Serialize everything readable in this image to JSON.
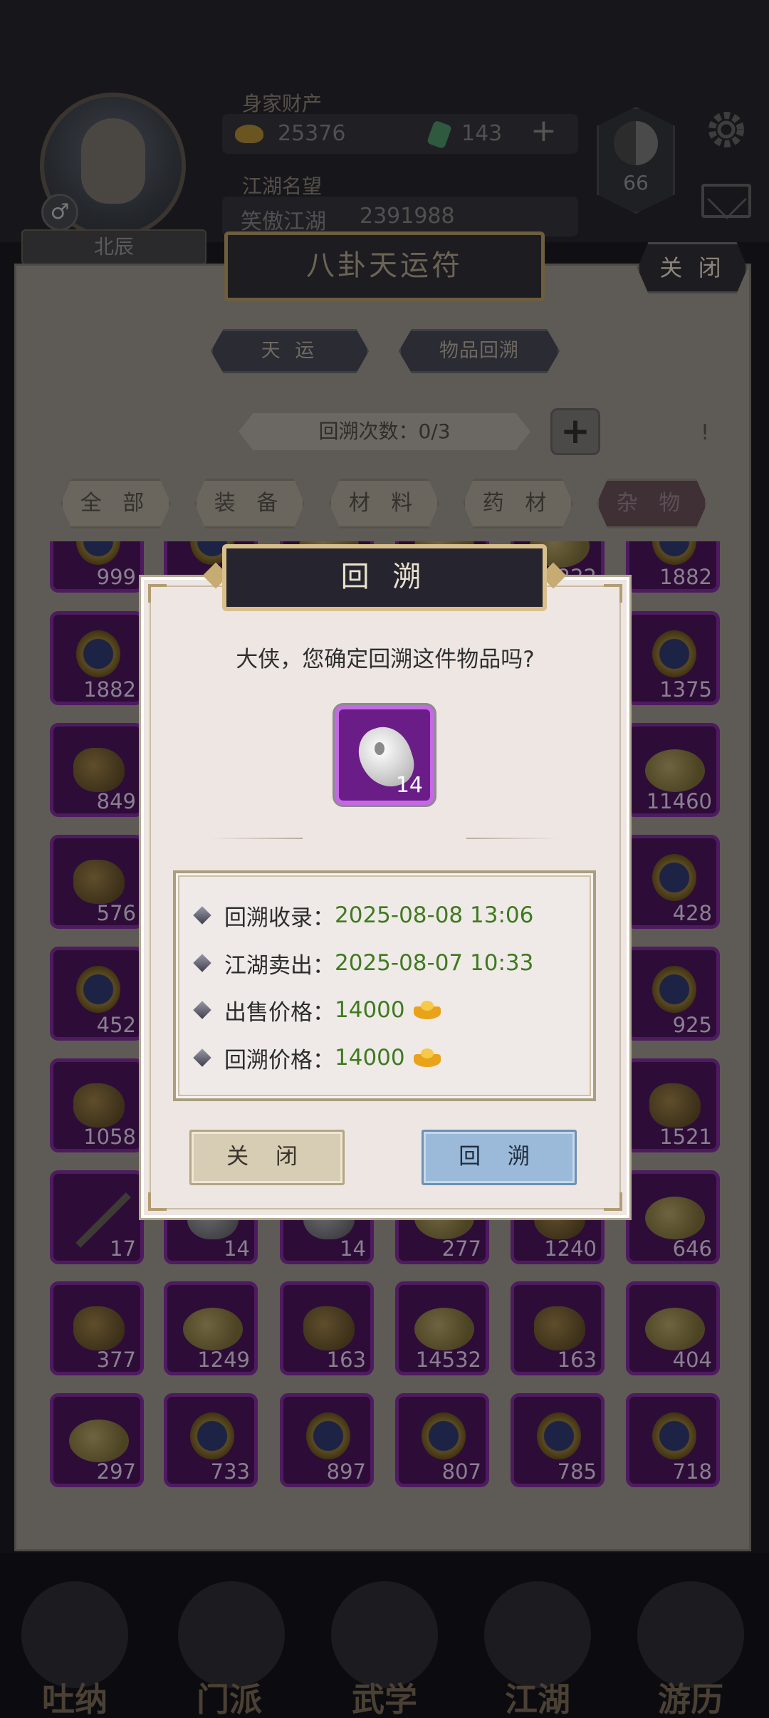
{
  "hud": {
    "wealth_label": "身家财产",
    "gold": "25376",
    "jade": "143",
    "fame_label": "江湖名望",
    "fame_title": "笑傲江湖",
    "fame_value": "2391988",
    "taiji_level": "66",
    "player_name": "北辰"
  },
  "panel": {
    "title": "八卦天运符",
    "close_label": "关 闭",
    "tabs": [
      "天 运",
      "物品回溯"
    ],
    "recall_count_label": "回溯次数：",
    "recall_count_value": "0/3",
    "info_mark": "!",
    "categories": [
      "全 部",
      "装 备",
      "材 料",
      "药 材",
      "杂 物"
    ],
    "active_category": "杂 物"
  },
  "grid": {
    "rows": [
      [
        {
          "icon": "amulet",
          "count": "999"
        },
        {
          "icon": "amulet",
          "count": ""
        },
        {
          "icon": "gold",
          "count": ""
        },
        {
          "icon": "gold",
          "count": ""
        },
        {
          "icon": "gold",
          "count": "222"
        },
        {
          "icon": "amulet",
          "count": "1882"
        }
      ],
      [
        {
          "icon": "amulet",
          "count": "1882"
        },
        {
          "icon": "amulet",
          "count": ""
        },
        {
          "icon": "amulet",
          "count": ""
        },
        {
          "icon": "amulet",
          "count": ""
        },
        {
          "icon": "amulet",
          "count": ""
        },
        {
          "icon": "amulet",
          "count": "1375"
        }
      ],
      [
        {
          "icon": "nugget",
          "count": "849"
        },
        {
          "icon": "gold",
          "count": ""
        },
        {
          "icon": "gold",
          "count": ""
        },
        {
          "icon": "gold",
          "count": ""
        },
        {
          "icon": "gold",
          "count": ""
        },
        {
          "icon": "gold",
          "count": "11460"
        }
      ],
      [
        {
          "icon": "nugget",
          "count": "576"
        },
        {
          "icon": "amulet",
          "count": ""
        },
        {
          "icon": "amulet",
          "count": ""
        },
        {
          "icon": "amulet",
          "count": ""
        },
        {
          "icon": "amulet",
          "count": ""
        },
        {
          "icon": "amulet",
          "count": "428"
        }
      ],
      [
        {
          "icon": "amulet",
          "count": "452"
        },
        {
          "icon": "amulet",
          "count": ""
        },
        {
          "icon": "amulet",
          "count": ""
        },
        {
          "icon": "amulet",
          "count": ""
        },
        {
          "icon": "amulet",
          "count": ""
        },
        {
          "icon": "amulet",
          "count": "925"
        }
      ],
      [
        {
          "icon": "nugget",
          "count": "1058"
        },
        {
          "icon": "nugget",
          "count": ""
        },
        {
          "icon": "nugget",
          "count": ""
        },
        {
          "icon": "nugget",
          "count": ""
        },
        {
          "icon": "nugget",
          "count": ""
        },
        {
          "icon": "nugget",
          "count": "1521"
        }
      ],
      [
        {
          "icon": "dagger",
          "count": "17"
        },
        {
          "icon": "stone",
          "count": "14"
        },
        {
          "icon": "stone",
          "count": "14"
        },
        {
          "icon": "gold",
          "count": "277"
        },
        {
          "icon": "nugget",
          "count": "1240"
        },
        {
          "icon": "gold",
          "count": "646"
        }
      ],
      [
        {
          "icon": "nugget",
          "count": "377"
        },
        {
          "icon": "gold",
          "count": "1249"
        },
        {
          "icon": "nugget",
          "count": "163"
        },
        {
          "icon": "gold",
          "count": "14532"
        },
        {
          "icon": "nugget",
          "count": "163"
        },
        {
          "icon": "gold",
          "count": "404"
        }
      ],
      [
        {
          "icon": "gold",
          "count": "297"
        },
        {
          "icon": "amulet",
          "count": "733"
        },
        {
          "icon": "amulet",
          "count": "897"
        },
        {
          "icon": "amulet",
          "count": "807"
        },
        {
          "icon": "amulet",
          "count": "785"
        },
        {
          "icon": "amulet",
          "count": "718"
        }
      ]
    ]
  },
  "bottom_nav": [
    "吐纳",
    "门派",
    "武学",
    "江湖",
    "游历"
  ],
  "dialog": {
    "title": "回 溯",
    "question": "大侠，您确定回溯这件物品吗?",
    "item_count": "14",
    "rows": [
      {
        "label": "回溯收录：",
        "value": "2025-08-08 13:06",
        "has_ingot": false
      },
      {
        "label": "江湖卖出：",
        "value": "2025-08-07 10:33",
        "has_ingot": false
      },
      {
        "label": "出售价格：",
        "value": "14000",
        "has_ingot": true
      },
      {
        "label": "回溯价格：",
        "value": "14000",
        "has_ingot": true
      }
    ],
    "close_label": "关 闭",
    "confirm_label": "回 溯"
  }
}
